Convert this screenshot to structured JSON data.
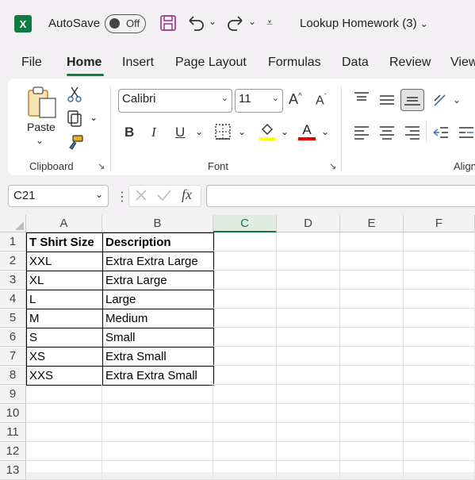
{
  "titlebar": {
    "app_logo": "X",
    "autosave_label": "AutoSave",
    "autosave_state": "Off",
    "doc_title": "Lookup Homework (3)"
  },
  "tabs": [
    "File",
    "Home",
    "Insert",
    "Page Layout",
    "Formulas",
    "Data",
    "Review",
    "View"
  ],
  "ribbon": {
    "clipboard": {
      "paste_label": "Paste",
      "group_label": "Clipboard"
    },
    "font": {
      "font_name": "Calibri",
      "font_size": "11",
      "group_label": "Font",
      "bold": "B",
      "italic": "I",
      "underline": "U",
      "grow": "A",
      "shrink": "A",
      "font_color_letter": "A"
    },
    "alignment": {
      "group_label": "Align"
    }
  },
  "formula_bar": {
    "name_box": "C21",
    "fx": "fx",
    "value": ""
  },
  "colors": {
    "accent": "#107c41",
    "highlight": "#ffff00",
    "font_color": "#e00000"
  },
  "sheet": {
    "columns": [
      "A",
      "B",
      "C",
      "D",
      "E",
      "F"
    ],
    "selected_column": "C",
    "rows": [
      "1",
      "2",
      "3",
      "4",
      "5",
      "6",
      "7",
      "8",
      "9",
      "10",
      "11",
      "12",
      "13"
    ],
    "cells": [
      [
        "T Shirt Size",
        "Description"
      ],
      [
        "XXL",
        "Extra Extra Large"
      ],
      [
        "XL",
        "Extra Large"
      ],
      [
        "L",
        "Large"
      ],
      [
        "M",
        "Medium"
      ],
      [
        "S",
        "Small"
      ],
      [
        "XS",
        "Extra Small"
      ],
      [
        "XXS",
        "Extra Extra Small"
      ]
    ]
  }
}
